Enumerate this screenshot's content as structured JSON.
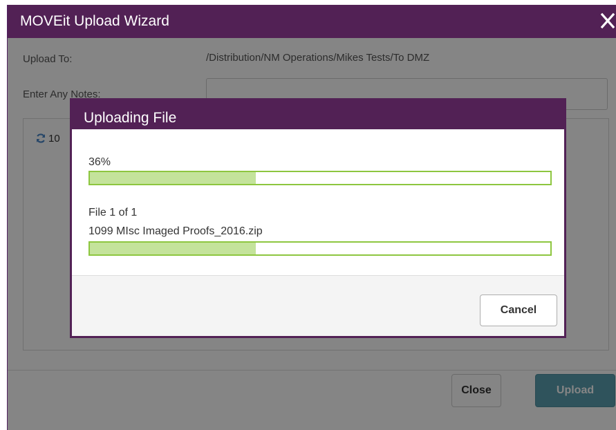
{
  "wizard": {
    "title": "MOVEit Upload Wizard",
    "upload_to_label": "Upload To:",
    "upload_to_value": "/Distribution/NM Operations/Mikes Tests/To DMZ",
    "notes_label": "Enter Any Notes:",
    "notes_value": "",
    "file_list_truncated_text": "10",
    "close_label": "Close",
    "upload_label": "Upload"
  },
  "dialog": {
    "title": "Uploading File",
    "overall_percent_text": "36%",
    "overall_progress": 0.36,
    "file_count_text": "File 1 of 1",
    "file_name": "1099 MIsc Imaged Proofs_2016.zip",
    "file_progress": 0.36,
    "cancel_label": "Cancel"
  },
  "colors": {
    "header": "#522155",
    "progress_border": "#8dc63f",
    "progress_fill": "#c4e39b",
    "upload_button": "#5a9fb0"
  },
  "icons": {
    "close": "close-icon",
    "refresh": "refresh-icon"
  }
}
